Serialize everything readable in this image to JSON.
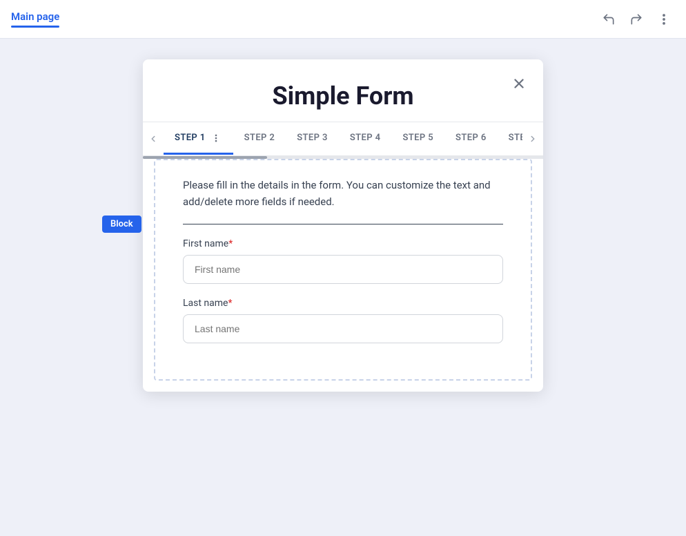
{
  "topBar": {
    "tab_label": "Main page",
    "undo_label": "↺",
    "redo_label": "↻",
    "more_label": "⋮"
  },
  "block_badge": "Block",
  "form": {
    "title": "Simple Form",
    "close_label": "×",
    "description": "Please fill in the details in the form. You can customize the text and add/delete more fields if needed.",
    "tabs": [
      {
        "label": "STEP 1",
        "active": true
      },
      {
        "label": "STEP 2",
        "active": false
      },
      {
        "label": "STEP 3",
        "active": false
      },
      {
        "label": "STEP 4",
        "active": false
      },
      {
        "label": "STEP 5",
        "active": false
      },
      {
        "label": "STEP 6",
        "active": false
      },
      {
        "label": "STEP",
        "active": false
      }
    ],
    "fields": [
      {
        "label": "First name",
        "required": true,
        "placeholder": "First name",
        "name": "first-name"
      },
      {
        "label": "Last name",
        "required": true,
        "placeholder": "Last name",
        "name": "last-name"
      }
    ]
  }
}
